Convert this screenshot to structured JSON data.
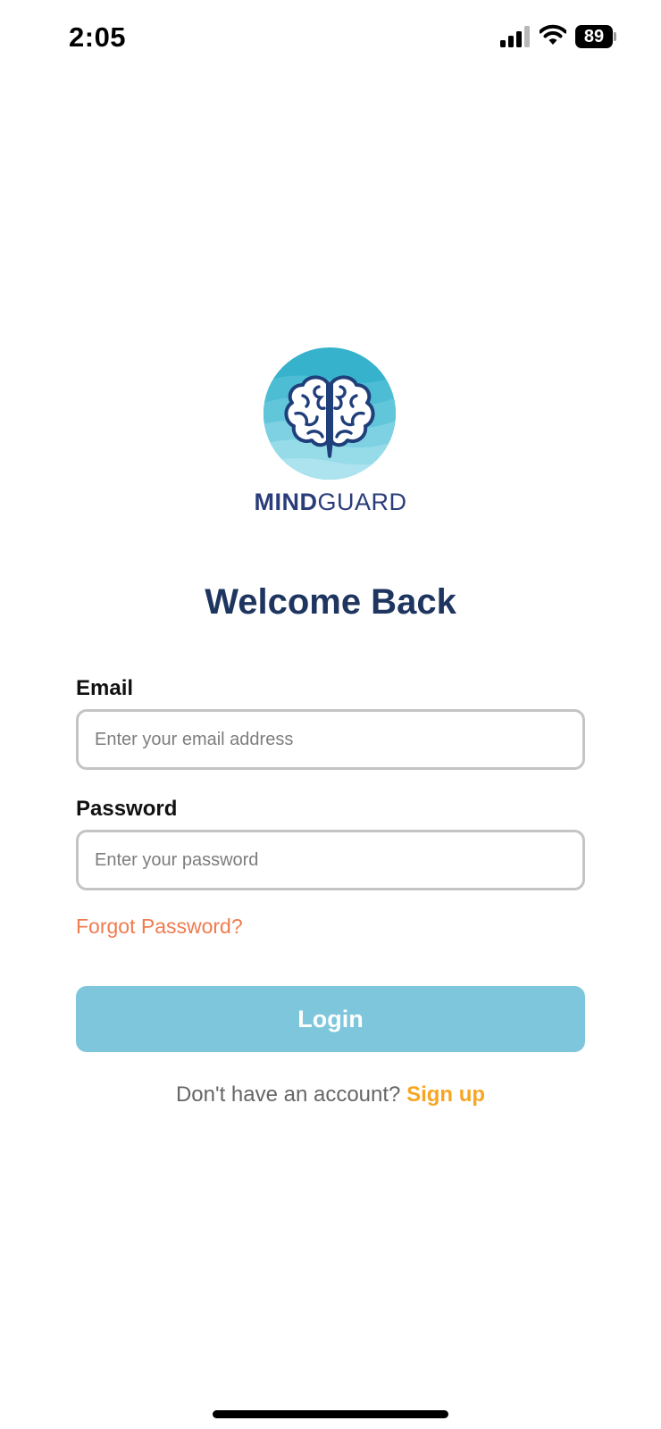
{
  "status_bar": {
    "time": "2:05",
    "battery_level": "89",
    "icons": [
      "signal-icon",
      "wifi-icon",
      "battery-icon"
    ]
  },
  "brand": {
    "name_bold": "MIND",
    "name_light": "GUARD",
    "logo_icon": "brain-icon",
    "color": "#2a3d7a"
  },
  "login": {
    "title": "Welcome Back",
    "email_label": "Email",
    "email_placeholder": "Enter your email address",
    "email_value": "",
    "password_label": "Password",
    "password_placeholder": "Enter your password",
    "password_value": "",
    "forgot_label": "Forgot Password?",
    "login_button_label": "Login",
    "signup_prompt": "Don't have an account?",
    "signup_link": "Sign up"
  },
  "colors": {
    "title": "#1e3560",
    "forgot_link": "#f07b4f",
    "login_button": "#7ec6dc",
    "signup_link": "#f6a623",
    "logo_circle_top": "#3bb5cf",
    "logo_circle_bottom": "#a7e1ec"
  }
}
